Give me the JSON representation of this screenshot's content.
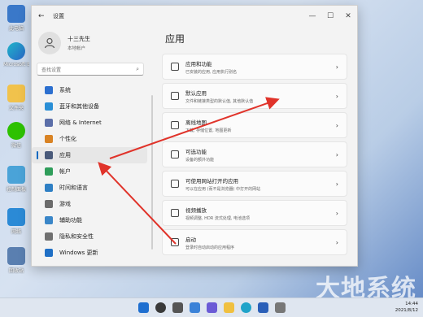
{
  "desktop": {
    "icons": [
      "此电脑",
      "Microsoft Edge",
      "文件夹",
      "微信",
      "控制面板",
      "网络",
      "回收站"
    ]
  },
  "window": {
    "title": "设置",
    "back_glyph": "←",
    "minimize_glyph": "—",
    "maximize_glyph": "☐",
    "close_glyph": "✕"
  },
  "user": {
    "name": "十三先生",
    "type": "本地帐户"
  },
  "search": {
    "placeholder": "查找设置"
  },
  "nav": [
    {
      "label": "系统",
      "color": "#2c6fcf"
    },
    {
      "label": "蓝牙和其他设备",
      "color": "#2a8fd6"
    },
    {
      "label": "网络 & Internet",
      "color": "#5b6ea8"
    },
    {
      "label": "个性化",
      "color": "#d98324"
    },
    {
      "label": "应用",
      "color": "#4a5a7a"
    },
    {
      "label": "帐户",
      "color": "#2f9d5a"
    },
    {
      "label": "时间和语言",
      "color": "#2e7fc4"
    },
    {
      "label": "游戏",
      "color": "#6b6b6b"
    },
    {
      "label": "辅助功能",
      "color": "#3a86c8"
    },
    {
      "label": "隐私和安全性",
      "color": "#707070"
    },
    {
      "label": "Windows 更新",
      "color": "#1f6fc5"
    }
  ],
  "main": {
    "title": "应用",
    "cards": [
      {
        "title": "应用和功能",
        "desc": "已安装的应用, 应用执行别名"
      },
      {
        "title": "默认应用",
        "desc": "文件和链接类型的默认值, 其他默认值"
      },
      {
        "title": "离线地图",
        "desc": "下载, 存储位置, 地图更新"
      },
      {
        "title": "可选功能",
        "desc": "设备的额外功能"
      },
      {
        "title": "可使用网站打开的应用",
        "desc": "可以在应用 (而不是浏览器) 中打开的网站"
      },
      {
        "title": "视频播放",
        "desc": "视频调整, HDR 流式处理, 电池选项"
      },
      {
        "title": "启动",
        "desc": "登录时自动启动的应用程序"
      }
    ]
  },
  "taskbar": {
    "time": "14:44",
    "date": "2021/8/12"
  },
  "watermark": "大地系统",
  "colors": {
    "accent": "#0067c0",
    "arrow": "#e0332a"
  }
}
